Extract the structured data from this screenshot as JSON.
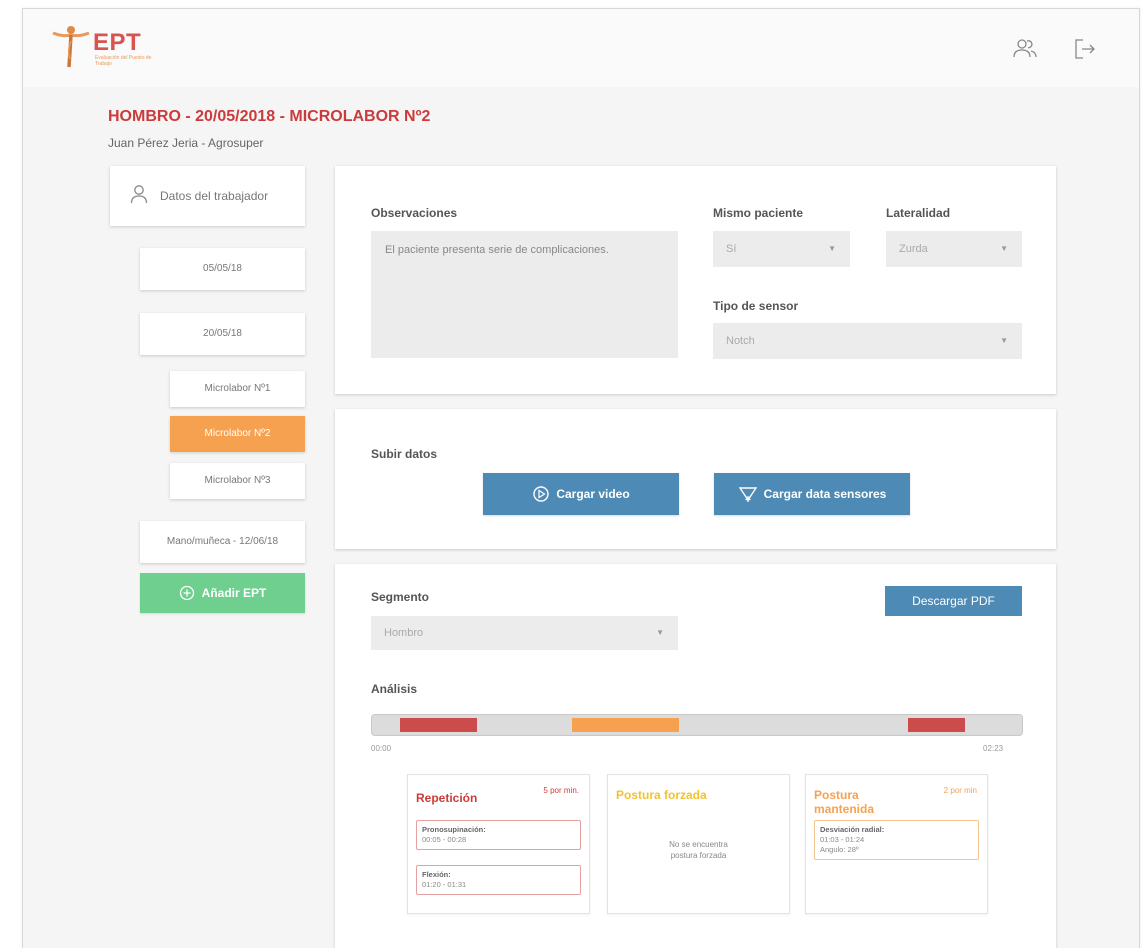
{
  "header": {
    "logo_text": "EPT",
    "logo_subtitle": "Evaluación del Puesto de Trabajo",
    "icons": [
      "users-icon",
      "logout-icon"
    ]
  },
  "page": {
    "title": "HOMBRO - 20/05/2018 - MICROLABOR Nº2",
    "subtitle": "Juan Pérez Jeria - Agrosuper"
  },
  "sidebar": {
    "worker_label": "Datos del trabajador",
    "dates": [
      "05/05/18",
      "20/05/18"
    ],
    "microlabores": [
      "Microlabor Nº1",
      "Microlabor Nº2",
      "Microlabor Nº3"
    ],
    "active_microlabor": "Microlabor Nº2",
    "other_ept": "Mano/muñeca - 12/06/18",
    "add_button": "Añadir EPT"
  },
  "form": {
    "observaciones_label": "Observaciones",
    "observaciones_value": "El paciente presenta serie de complicaciones.",
    "mismo_paciente_label": "Mismo paciente",
    "mismo_paciente_value": "Sí",
    "lateralidad_label": "Lateralidad",
    "lateralidad_value": "Zurda",
    "tipo_sensor_label": "Tipo de sensor",
    "tipo_sensor_value": "Notch"
  },
  "upload": {
    "label": "Subir datos",
    "video_button": "Cargar video",
    "sensors_button": "Cargar data sensores"
  },
  "analysis": {
    "segmento_label": "Segmento",
    "segmento_value": "Hombro",
    "pdf_button": "Descargar PDF",
    "analisis_label": "Análisis",
    "time_start": "00:00",
    "time_end": "02:23",
    "segments": [
      {
        "type": "repeticion",
        "start": 0.043,
        "end": 0.162,
        "color": "#cc4b4b"
      },
      {
        "type": "postura_forzada",
        "start": 0.307,
        "end": 0.471,
        "color": "#f6a150"
      },
      {
        "type": "repeticion",
        "start": 0.824,
        "end": 0.911,
        "color": "#cc4b4b"
      }
    ],
    "panels": {
      "repeticion": {
        "title": "Repetición",
        "rate": "5 por min.",
        "color": "#cc3b3b",
        "items": [
          {
            "title": "Pronosupinación:",
            "detail": "00:05 - 00:28"
          },
          {
            "title": "Flexión:",
            "detail": "01:20 - 01:31"
          }
        ]
      },
      "postura_forzada": {
        "title": "Postura forzada",
        "color": "#f2c230",
        "empty_line1": "No se encuentra",
        "empty_line2": "postura forzada"
      },
      "postura_mantenida": {
        "title_line1": "Postura",
        "title_line2": "mantenida",
        "rate": "2 por min",
        "color": "#f6a150",
        "items": [
          {
            "title": "Desviación radial:",
            "detail": "01:03 - 01:24",
            "extra": "Angulo: 28º"
          }
        ]
      }
    }
  }
}
